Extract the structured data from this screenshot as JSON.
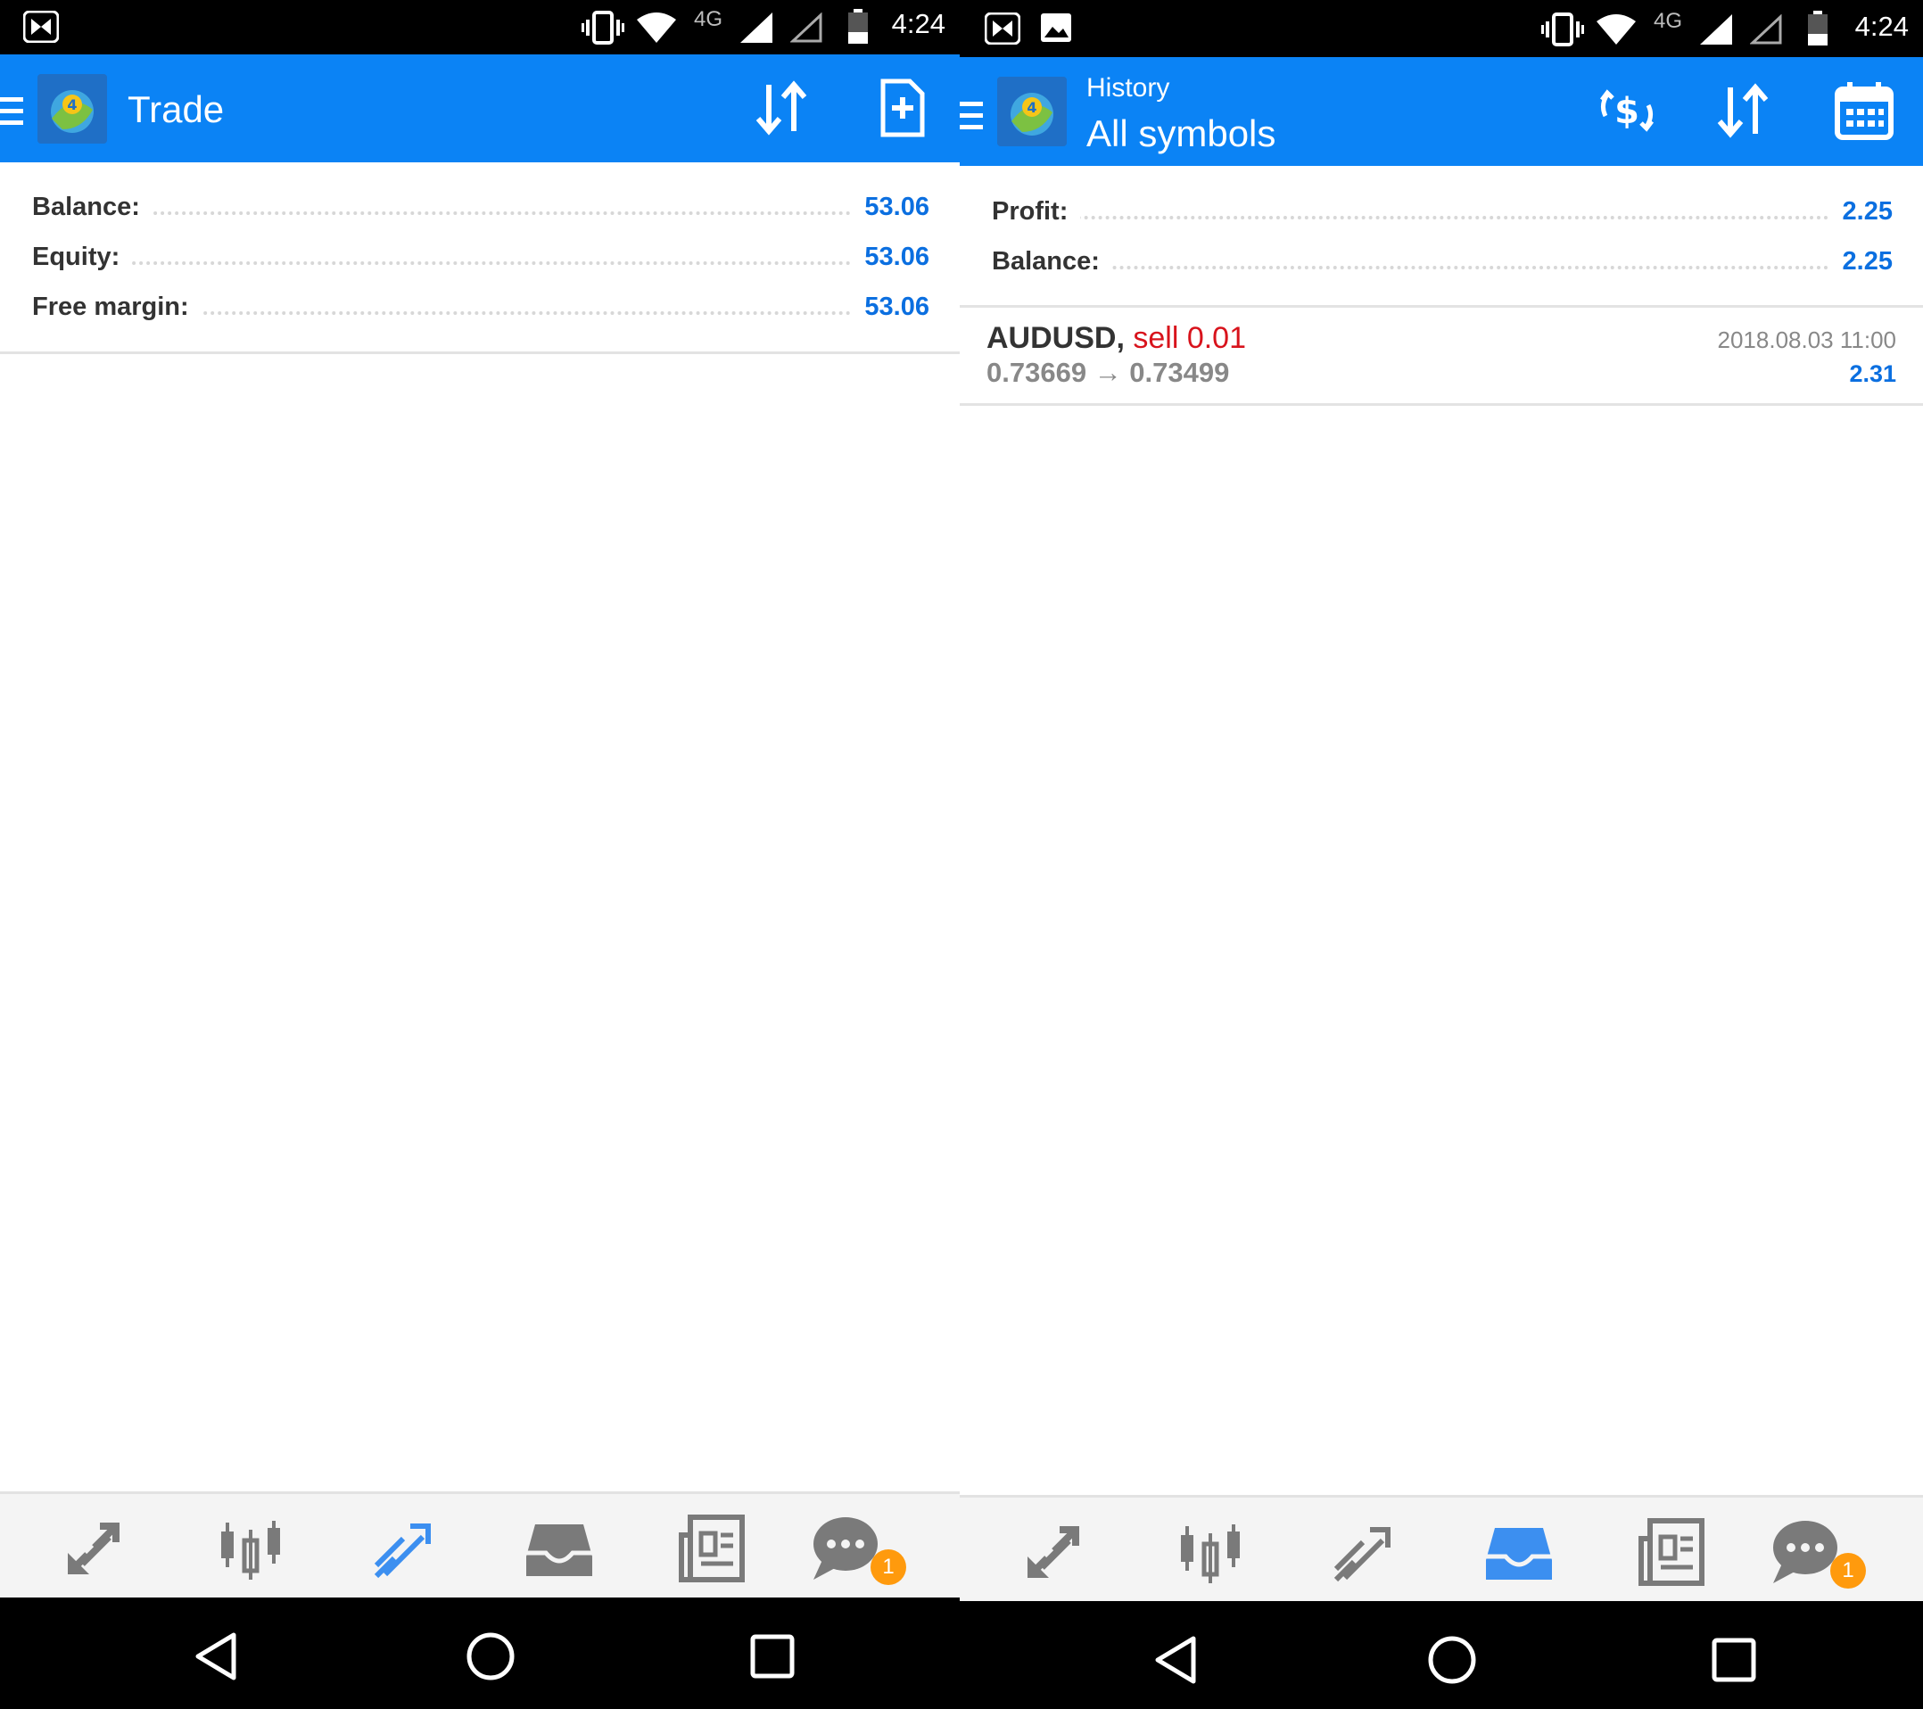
{
  "status_bar": {
    "time": "4:24",
    "network": "4G"
  },
  "trade_screen": {
    "title": "Trade",
    "summary": [
      {
        "label": "Balance:",
        "value": "53.06"
      },
      {
        "label": "Equity:",
        "value": "53.06"
      },
      {
        "label": "Free margin:",
        "value": "53.06"
      }
    ],
    "chat_badge": "1"
  },
  "history_screen": {
    "title_small": "History",
    "title_big": "All symbols",
    "summary": [
      {
        "label": "Profit:",
        "value": "2.25"
      },
      {
        "label": "Balance:",
        "value": "2.25"
      }
    ],
    "deals": [
      {
        "symbol": "AUDUSD,",
        "type": "sell 0.01",
        "prices": "0.73669 → 0.73499",
        "datetime": "2018.08.03 11:00",
        "profit": "2.31"
      }
    ],
    "chat_badge": "1"
  },
  "bottom_nav": {
    "items": [
      "quotes-icon",
      "chart-icon",
      "trade-icon",
      "history-icon",
      "news-icon",
      "chat-icon"
    ]
  },
  "colors": {
    "appbar": "#0b83f5",
    "active_tab": "#3c8ff0",
    "value_blue": "#0b6fe0",
    "sell_red": "#d8131c",
    "badge": "#ff9a0d"
  }
}
